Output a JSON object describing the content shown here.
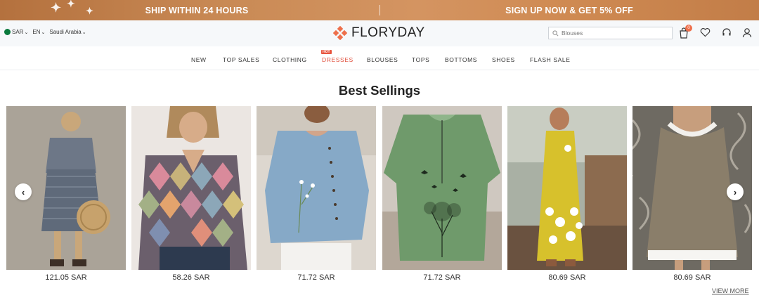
{
  "promo": {
    "left_text": "SHIP WITHIN 24 HOURS",
    "right_text": "SIGN UP NOW & GET 5% OFF"
  },
  "header": {
    "currency": "SAR",
    "language": "EN",
    "country": "Saudi Arabia",
    "logo_text": "FLORYDAY",
    "search_placeholder": "Blouses",
    "cart_count": "0",
    "icons": [
      "cart-icon",
      "heart-icon",
      "headset-icon",
      "user-icon"
    ]
  },
  "nav": {
    "items": [
      "NEW",
      "TOP SALES",
      "CLOTHING",
      "DRESSES",
      "BLOUSES",
      "TOPS",
      "BOTTOMS",
      "SHOES",
      "FLASH SALE"
    ],
    "hot_label": "HOT"
  },
  "section": {
    "title": "Best Sellings",
    "view_more": "VIEW MORE"
  },
  "products": [
    {
      "price": "121.05 SAR"
    },
    {
      "price": "58.26 SAR"
    },
    {
      "price": "71.72 SAR"
    },
    {
      "price": "71.72 SAR"
    },
    {
      "price": "80.69 SAR"
    },
    {
      "price": "80.69 SAR"
    }
  ],
  "colors": {
    "accent": "#e04f3c",
    "promo_bg": "#c98a55",
    "logo_mark": "#ee6f4b"
  }
}
